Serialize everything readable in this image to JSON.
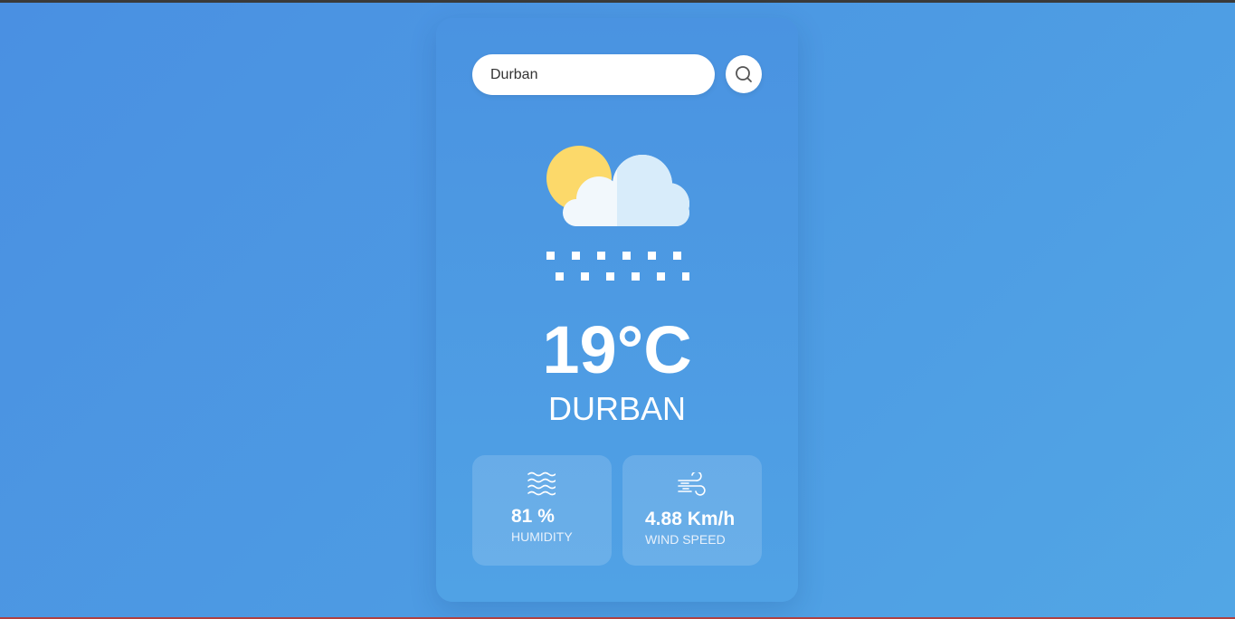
{
  "search": {
    "value": "Durban",
    "placeholder": ""
  },
  "weather": {
    "condition_icon": "sun-cloud-snow-icon",
    "temperature": "19°C",
    "city": "DURBAN"
  },
  "details": {
    "humidity": {
      "icon": "humidity-waves-icon",
      "value": "81 %",
      "label": "HUMIDITY"
    },
    "wind": {
      "icon": "wind-icon",
      "value": "4.88 Km/h",
      "label": "WIND SPEED"
    }
  },
  "colors": {
    "background": "#4a90e2",
    "card": "#4a93e1",
    "sun": "#fcd96a",
    "cloud_light": "#f2f8fc",
    "cloud_shade": "#d8ecfa"
  }
}
